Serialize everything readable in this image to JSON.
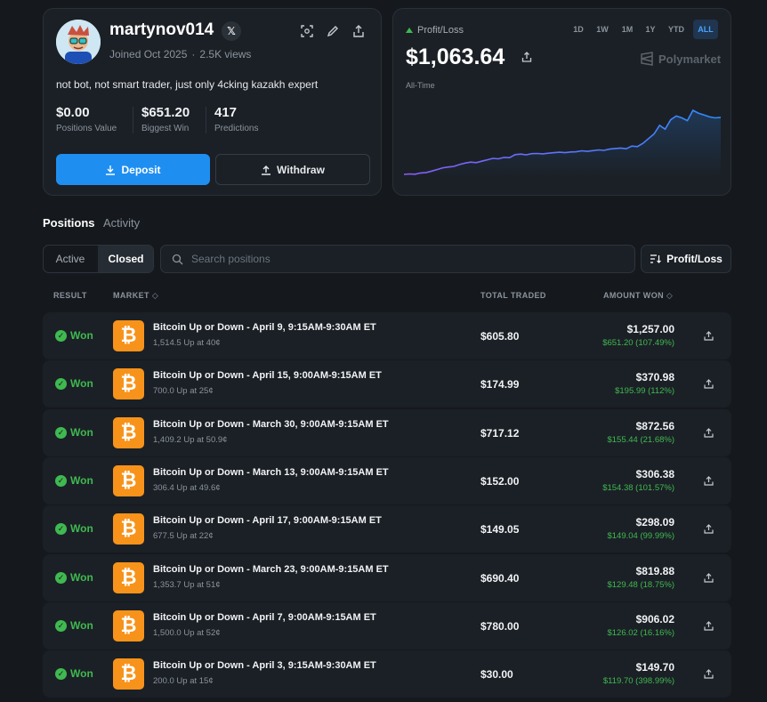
{
  "profile": {
    "username": "martynov014",
    "x_badge": "𝕏",
    "joined": "Joined Oct 2025",
    "views": "2.5K views",
    "bio": "not bot, not smart trader, just only 4cking kazakh expert",
    "stats": [
      {
        "value": "$0.00",
        "label": "Positions Value"
      },
      {
        "value": "$651.20",
        "label": "Biggest Win"
      },
      {
        "value": "417",
        "label": "Predictions"
      }
    ],
    "deposit_label": "Deposit",
    "withdraw_label": "Withdraw"
  },
  "pnl": {
    "label": "Profit/Loss",
    "value": "$1,063.64",
    "period": "All-Time",
    "ranges": [
      "1D",
      "1W",
      "1M",
      "1Y",
      "YTD",
      "ALL"
    ],
    "active_range": "ALL",
    "brand": "Polymarket",
    "colors": {
      "line_start": "#8b5cf6",
      "line_end": "#2f8cff",
      "positive": "#3fb950"
    },
    "series": [
      0,
      0.5,
      0.2,
      1.5,
      2,
      3.5,
      5.2,
      7,
      7.8,
      8.5,
      10.5,
      12,
      13,
      12.5,
      14,
      15.5,
      17,
      16.5,
      18,
      17.8,
      21,
      21.5,
      20.8,
      22,
      22.2,
      21.8,
      22.5,
      23,
      23.5,
      23,
      23.8,
      24,
      25,
      24.5,
      25.2,
      26,
      25.5,
      26.8,
      27.5,
      28,
      27.2,
      30,
      29.5,
      33,
      38,
      43,
      52,
      48,
      58,
      62,
      60,
      57,
      68,
      65,
      63,
      61,
      60,
      60.5
    ]
  },
  "tabs": {
    "positions": "Positions",
    "activity": "Activity"
  },
  "filters": {
    "active_label": "Active",
    "closed_label": "Closed",
    "search_placeholder": "Search positions",
    "sort_label": "Profit/Loss"
  },
  "table": {
    "headers": {
      "result": "RESULT",
      "market": "MARKET",
      "traded": "TOTAL TRADED",
      "amount": "AMOUNT WON"
    },
    "rows": [
      {
        "result": "Won",
        "title": "Bitcoin Up or Down - April 9, 9:15AM-9:30AM ET",
        "sub": "1,514.5 Up at 40¢",
        "traded": "$605.80",
        "amount": "$1,257.00",
        "gain": "$651.20 (107.49%)"
      },
      {
        "result": "Won",
        "title": "Bitcoin Up or Down - April 15, 9:00AM-9:15AM ET",
        "sub": "700.0 Up at 25¢",
        "traded": "$174.99",
        "amount": "$370.98",
        "gain": "$195.99 (112%)"
      },
      {
        "result": "Won",
        "title": "Bitcoin Up or Down - March 30, 9:00AM-9:15AM ET",
        "sub": "1,409.2 Up at 50.9¢",
        "traded": "$717.12",
        "amount": "$872.56",
        "gain": "$155.44 (21.68%)"
      },
      {
        "result": "Won",
        "title": "Bitcoin Up or Down - March 13, 9:00AM-9:15AM ET",
        "sub": "306.4 Up at 49.6¢",
        "traded": "$152.00",
        "amount": "$306.38",
        "gain": "$154.38 (101.57%)"
      },
      {
        "result": "Won",
        "title": "Bitcoin Up or Down - April 17, 9:00AM-9:15AM ET",
        "sub": "677.5 Up at 22¢",
        "traded": "$149.05",
        "amount": "$298.09",
        "gain": "$149.04 (99.99%)"
      },
      {
        "result": "Won",
        "title": "Bitcoin Up or Down - March 23, 9:00AM-9:15AM ET",
        "sub": "1,353.7 Up at 51¢",
        "traded": "$690.40",
        "amount": "$819.88",
        "gain": "$129.48 (18.75%)"
      },
      {
        "result": "Won",
        "title": "Bitcoin Up or Down - April 7, 9:00AM-9:15AM ET",
        "sub": "1,500.0 Up at 52¢",
        "traded": "$780.00",
        "amount": "$906.02",
        "gain": "$126.02 (16.16%)"
      },
      {
        "result": "Won",
        "title": "Bitcoin Up or Down - April 3, 9:15AM-9:30AM ET",
        "sub": "200.0 Up at 15¢",
        "traded": "$30.00",
        "amount": "$149.70",
        "gain": "$119.70 (398.99%)"
      }
    ]
  }
}
